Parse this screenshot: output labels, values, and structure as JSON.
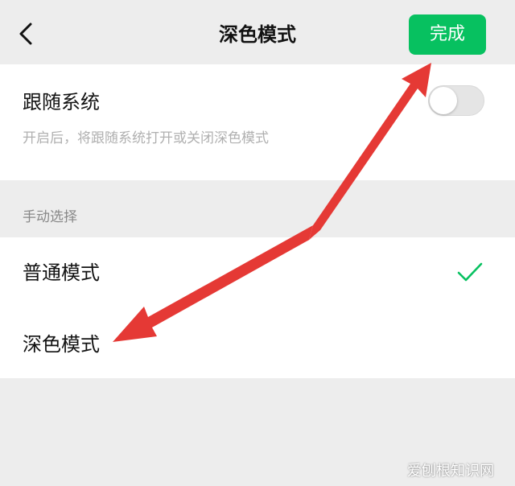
{
  "header": {
    "title": "深色模式",
    "done_label": "完成",
    "back_icon": "chevron-left-icon"
  },
  "follow_system": {
    "label": "跟随系统",
    "description": "开启后，将跟随系统打开或关闭深色模式",
    "enabled": false
  },
  "manual_section": {
    "label": "手动选择",
    "options": [
      {
        "label": "普通模式",
        "selected": true
      },
      {
        "label": "深色模式",
        "selected": false
      }
    ]
  },
  "watermark": "爱刨根知识网",
  "colors": {
    "accent": "#07c160",
    "background": "#ededed",
    "card": "#ffffff",
    "annotation_arrow": "#e53935"
  }
}
